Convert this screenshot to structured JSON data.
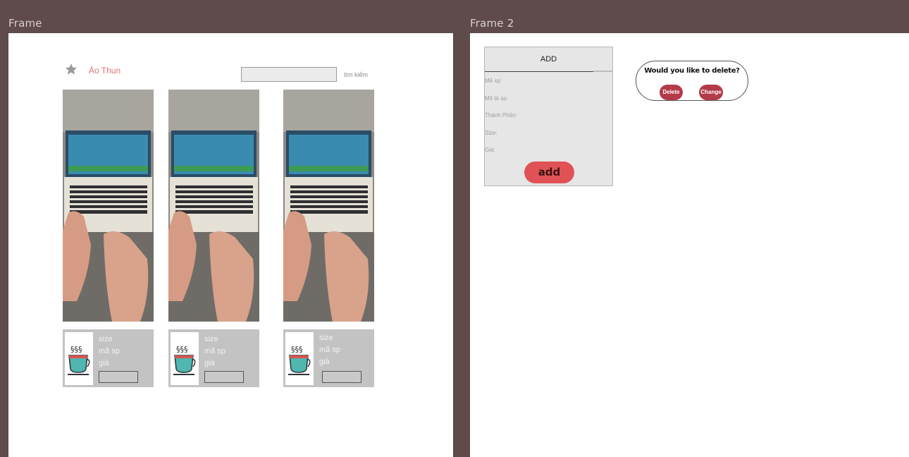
{
  "frames": {
    "frame1_label": "Frame",
    "frame2_label": "Frame 2"
  },
  "header": {
    "star_icon": "star-icon",
    "brand": "Áo Thun",
    "search_value": "",
    "search_label": "tìm kiếm"
  },
  "products": [
    {
      "size_label": "size",
      "code_label": "mã sp",
      "price_label": "giá",
      "thumb_icon": "coffee-cup-icon"
    },
    {
      "size_label": "size",
      "code_label": "mã sp",
      "price_label": "giá",
      "thumb_icon": "coffee-cup-icon"
    },
    {
      "size_label": "size",
      "code_label": "mã sp",
      "price_label": "giá",
      "thumb_icon": "coffee-cup-icon"
    }
  ],
  "add_form": {
    "title": "ADD",
    "fields": [
      "Mã sp:",
      "Mô tả sp:",
      "Thành Phần:",
      "Size:",
      "Giá:"
    ],
    "button": "add"
  },
  "delete_dialog": {
    "question": "Would you like to delete?",
    "delete_label": "Delete",
    "change_label": "Change"
  },
  "colors": {
    "background": "#5f4b4b",
    "brand": "#e07171",
    "add_button": "#e05256",
    "pill": "#b33a48"
  }
}
